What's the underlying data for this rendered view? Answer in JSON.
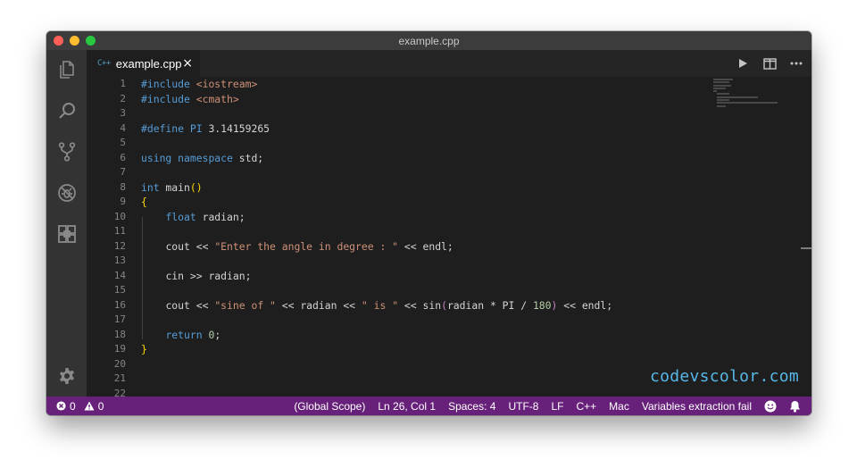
{
  "window": {
    "title": "example.cpp"
  },
  "activity_bar": {
    "icons": [
      "explorer-icon",
      "search-icon",
      "source-control-icon",
      "debug-icon",
      "extensions-icon",
      "gear-icon"
    ]
  },
  "tab": {
    "lang_badge": "C++",
    "filename": "example.cpp",
    "close_glyph": "×"
  },
  "editor_actions": [
    "run-icon",
    "split-editor-icon",
    "more-icon"
  ],
  "line_numbers": [
    "1",
    "2",
    "3",
    "4",
    "5",
    "6",
    "7",
    "8",
    "9",
    "10",
    "11",
    "12",
    "13",
    "14",
    "15",
    "16",
    "17",
    "18",
    "19",
    "20",
    "21",
    "22"
  ],
  "code": {
    "l1": {
      "pp": "#include",
      "val": " <iostream>"
    },
    "l2": {
      "pp": "#include",
      "val": " <cmath>"
    },
    "l4": {
      "pp": "#define",
      "name": " PI",
      "val": " 3.14159265"
    },
    "l6": {
      "kw1": "using",
      "kw2": " namespace",
      "rest": " std;"
    },
    "l8": {
      "type": "int",
      "rest": " main",
      "paren": "()"
    },
    "l9": {
      "brace": "{"
    },
    "l10": {
      "indent": "    ",
      "type": "float",
      "rest": " radian;"
    },
    "l12": {
      "indent": "    ",
      "pre": "cout << ",
      "str": "\"Enter the angle in degree : \"",
      "post": " << endl;"
    },
    "l14": {
      "indent": "    ",
      "text": "cin >> radian;"
    },
    "l16": {
      "indent": "    ",
      "pre": "cout << ",
      "str1": "\"sine of \"",
      "mid1": " << radian << ",
      "str2": "\" is \"",
      "mid2": " << ",
      "fn": "sin",
      "p1": "(",
      "args": "radian * PI / ",
      "num": "180",
      "p2": ")",
      "post": " << endl;"
    },
    "l18": {
      "indent": "    ",
      "kw": "return",
      "num": " 0",
      "rest": ";"
    },
    "l19": {
      "brace": "}"
    }
  },
  "watermark": "codevscolor.com",
  "status_bar": {
    "errors": "0",
    "warnings": "0",
    "scope": "(Global Scope)",
    "position": "Ln 26, Col 1",
    "spaces": "Spaces: 4",
    "encoding": "UTF-8",
    "eol": "LF",
    "language": "C++",
    "platform": "Mac",
    "message": "Variables extraction fail"
  },
  "colors": {
    "status_bar": "#68217a",
    "editor_bg": "#1e1e1e",
    "activity_bar": "#333333",
    "keyword": "#569cd6",
    "string": "#ce9178",
    "number": "#b5cea8",
    "function": "#dcdcaa",
    "bracket": "#ffd700"
  }
}
